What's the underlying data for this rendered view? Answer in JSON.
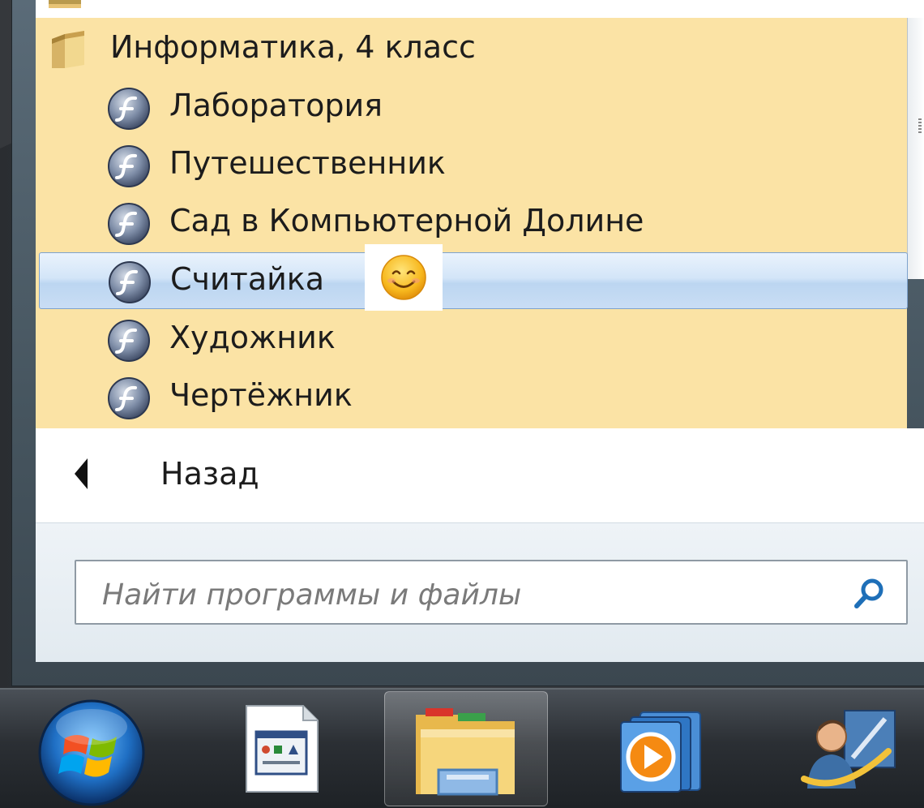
{
  "folder": {
    "label": "Информатика, 4 класс",
    "icon": "folder-icon"
  },
  "programs": [
    {
      "label": "Лаборатория",
      "icon": "flash-icon",
      "selected": false
    },
    {
      "label": "Путешественник",
      "icon": "flash-icon",
      "selected": false
    },
    {
      "label": "Сад в Компьютерной Долине",
      "icon": "flash-icon",
      "selected": false
    },
    {
      "label": "Считайка",
      "icon": "flash-icon",
      "selected": true
    },
    {
      "label": "Художник",
      "icon": "flash-icon",
      "selected": false
    },
    {
      "label": "Чертёжник",
      "icon": "flash-icon",
      "selected": false
    }
  ],
  "back": {
    "label": "Назад"
  },
  "search": {
    "placeholder": "Найти программы и файлы",
    "value": ""
  },
  "colors": {
    "list_highlight": "#fbe3a5",
    "selection": "#c9ddf4",
    "taskbar": "#2b2f34"
  },
  "taskbar": {
    "items": [
      "start-orb-icon",
      "application-window-icon",
      "file-explorer-icon",
      "media-player-icon",
      "user-network-icon"
    ]
  }
}
